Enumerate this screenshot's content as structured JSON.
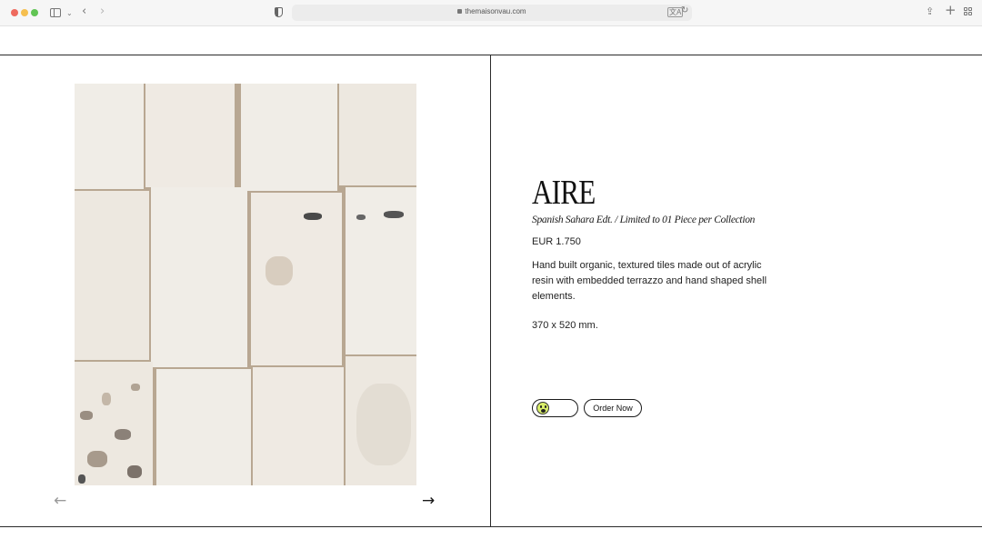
{
  "browser": {
    "url": "themaisonvau.com"
  },
  "gallery": {
    "image_alt": "tile-image",
    "prev_arrow": "←",
    "next_arrow": "→"
  },
  "product": {
    "title": "AIRE",
    "subtitle": "Spanish Sahara Edt. / Limited to 01 Piece per Collection",
    "price": "EUR 1.750",
    "description": "Hand built organic, textured tiles made out of acrylic resin with embedded terrazzo and hand shaped shell elements.",
    "dimensions": "370 x 520 mm.",
    "order_label": "Order Now"
  },
  "icons": {
    "emoji": "face-icon",
    "emoji_color": "#d9ee6a"
  }
}
